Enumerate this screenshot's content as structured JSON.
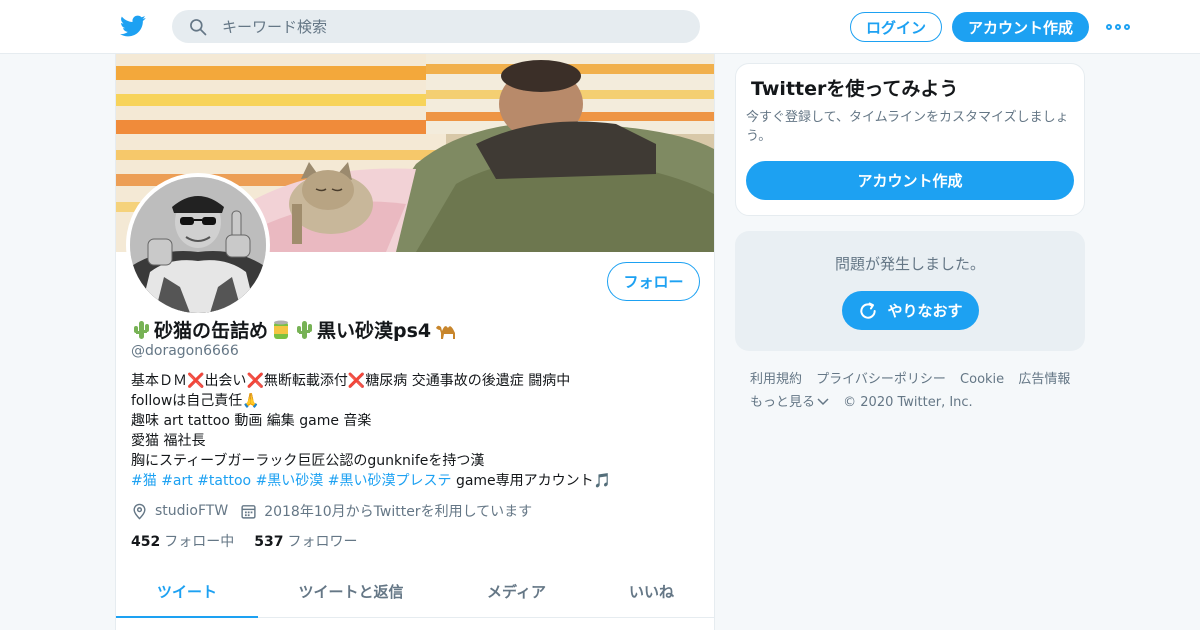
{
  "header": {
    "logo_icon": "twitter-bird-icon",
    "search": {
      "placeholder": "キーワード検索",
      "icon": "search-icon"
    },
    "login_label": "ログイン",
    "signup_label": "アカウント作成",
    "more_icon": "more-dots-icon"
  },
  "profile": {
    "banner": "banner-photo",
    "avatar": "avatar-photo",
    "follow_label": "フォロー",
    "name_parts": [
      "砂猫の缶詰め",
      "黒い砂漠ps4"
    ],
    "name_emojis": [
      "cactus-emoji",
      "can-emoji",
      "cactus-emoji",
      "camel-emoji"
    ],
    "handle": "@doragon6666",
    "bio": {
      "line1_prefix": "基本ＤＭ",
      "line1_items": [
        "出会い",
        "無断転載添付",
        "糖尿病 交通事故の後遺症 闘病中"
      ],
      "line2": "followは自己責任",
      "line3": "趣味 art tattoo 動画 編集 game 音楽",
      "line4": "愛猫 福社長",
      "line5": "胸にスティーブガーラック巨匠公認のgunknifeを持つ漢",
      "hashtags": [
        "#猫",
        "#art",
        "#tattoo",
        "#黒い砂漠",
        "#黒い砂漠プレステ"
      ],
      "line6_suffix": "game専用アカウント"
    },
    "location": "studioFTW",
    "joined": "2018年10月からTwitterを利用しています",
    "following_count": "452",
    "following_label": "フォロー中",
    "followers_count": "537",
    "followers_label": "フォロワー",
    "tabs": [
      {
        "label": "ツイート",
        "active": true
      },
      {
        "label": "ツイートと返信",
        "active": false
      },
      {
        "label": "メディア",
        "active": false
      },
      {
        "label": "いいね",
        "active": false
      }
    ]
  },
  "sidebar": {
    "signup_card": {
      "title": "Twitterを使ってみよう",
      "text": "今すぐ登録して、タイムラインをカスタマイズしましょう。",
      "button": "アカウント作成"
    },
    "error_card": {
      "message": "問題が発生しました。",
      "retry_label": "やりなおす"
    },
    "footer": {
      "links_row1": [
        "利用規約",
        "プライバシーポリシー",
        "Cookie",
        "広告情報"
      ],
      "more_label": "もっと見る",
      "copyright": "© 2020 Twitter, Inc."
    }
  },
  "colors": {
    "accent": "#1da1f2",
    "text": "#14171a",
    "muted": "#657786",
    "background": "#f5f8fa"
  }
}
